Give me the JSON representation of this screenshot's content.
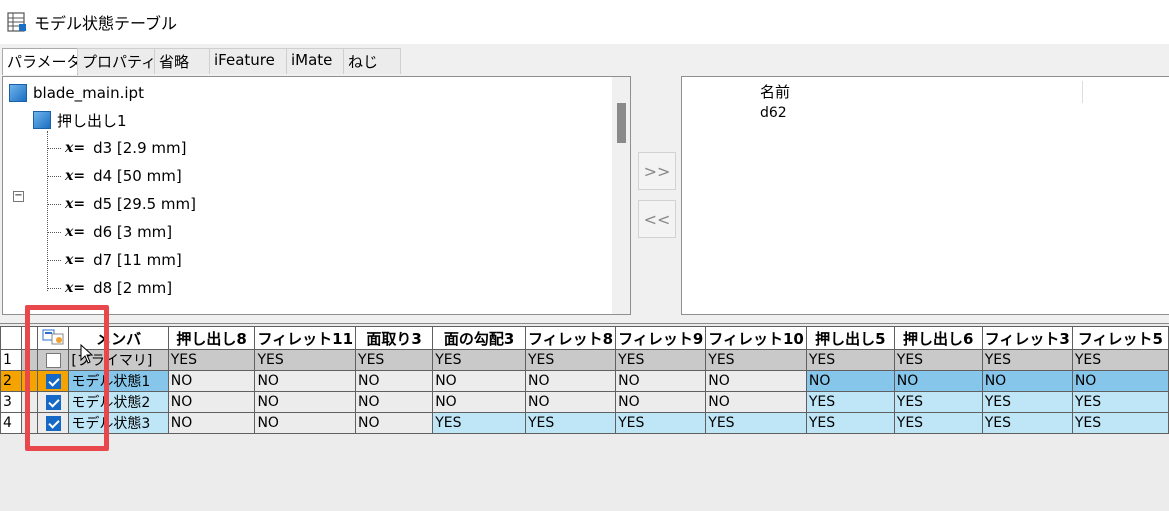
{
  "window": {
    "title": "モデル状態テーブル",
    "icon": "table-icon"
  },
  "tabs": [
    {
      "label": "パラメータ",
      "active": true
    },
    {
      "label": "プロパティ",
      "active": false
    },
    {
      "label": "省略",
      "active": false
    },
    {
      "label": "iFeature",
      "active": false
    },
    {
      "label": "iMate",
      "active": false
    },
    {
      "label": "ねじ",
      "active": false
    }
  ],
  "tree": {
    "root": "blade_main.ipt",
    "feature": "押し出し1",
    "params": [
      "d3 [2.9 mm]",
      "d4 [50 mm]",
      "d5 [29.5 mm]",
      "d6 [3 mm]",
      "d7 [11 mm]",
      "d8 [2 mm]"
    ],
    "param_symbol": "x="
  },
  "transfer": {
    "add": ">>",
    "remove": "<<"
  },
  "selected_list": {
    "header": "名前",
    "items": [
      "d62"
    ]
  },
  "grid": {
    "headers": [
      "メンバ",
      "押し出し8",
      "フィレット11",
      "面取り3",
      "面の勾配3",
      "フィレット8",
      "フィレット9",
      "フィレット10",
      "押し出し5",
      "押し出し6",
      "フィレット3",
      "フィレット5"
    ],
    "rows": [
      {
        "num": "1",
        "checked": false,
        "member": "[プライマリ]",
        "values": [
          "YES",
          "YES",
          "YES",
          "YES",
          "YES",
          "YES",
          "YES",
          "YES",
          "YES",
          "YES",
          "YES"
        ]
      },
      {
        "num": "2",
        "checked": true,
        "member": "モデル状態1",
        "values": [
          "NO",
          "NO",
          "NO",
          "NO",
          "NO",
          "NO",
          "NO",
          "NO",
          "NO",
          "NO",
          "NO"
        ]
      },
      {
        "num": "3",
        "checked": true,
        "member": "モデル状態2",
        "values": [
          "NO",
          "NO",
          "NO",
          "NO",
          "NO",
          "NO",
          "NO",
          "YES",
          "YES",
          "YES",
          "YES"
        ]
      },
      {
        "num": "4",
        "checked": true,
        "member": "モデル状態3",
        "values": [
          "NO",
          "NO",
          "NO",
          "YES",
          "YES",
          "YES",
          "YES",
          "YES",
          "YES",
          "YES",
          "YES"
        ]
      }
    ]
  },
  "colors": {
    "highlight": "#e8474b",
    "selected_row": "#f5a300",
    "checkbox": "#1668c6"
  }
}
